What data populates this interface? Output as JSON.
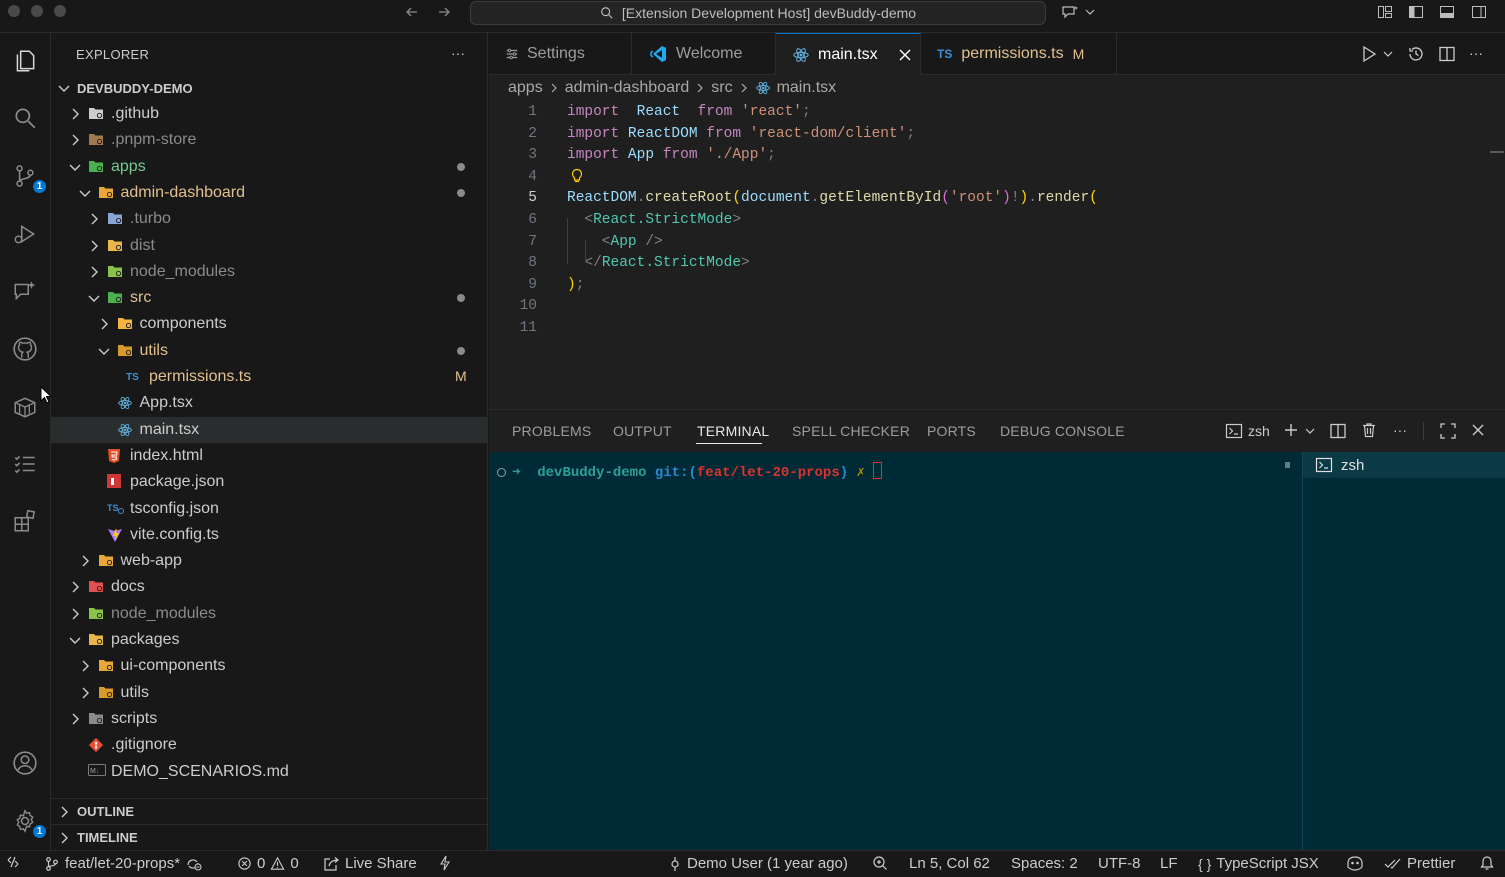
{
  "window": {
    "title": "[Extension Development Host] devBuddy-demo"
  },
  "activity_bar": {
    "scm_badge": "1",
    "settings_badge": "1"
  },
  "sidebar": {
    "title": "EXPLORER",
    "more_label": "···",
    "root": "DEVBUDDY-DEMO",
    "tree": [
      {
        "label": ".github",
        "level": 1,
        "kind": "folder",
        "expanded": false,
        "icon_color": "#cccccc"
      },
      {
        "label": ".pnpm-store",
        "level": 1,
        "kind": "folder",
        "expanded": false,
        "dim": true,
        "icon_color": "#a07a4d"
      },
      {
        "label": "apps",
        "level": 1,
        "kind": "folder",
        "expanded": true,
        "icon_color": "#4caf50",
        "status": "dot",
        "text_color": "#73c991"
      },
      {
        "label": "admin-dashboard",
        "level": 2,
        "kind": "folder",
        "expanded": true,
        "icon_color": "#e8a73a",
        "status": "dot",
        "text_color": "#e2c08d"
      },
      {
        "label": ".turbo",
        "level": 3,
        "kind": "folder",
        "expanded": false,
        "dim": true,
        "icon_color": "#8aa4d6"
      },
      {
        "label": "dist",
        "level": 3,
        "kind": "folder",
        "expanded": false,
        "dim": true,
        "icon_color": "#e8b64a"
      },
      {
        "label": "node_modules",
        "level": 3,
        "kind": "folder",
        "expanded": false,
        "dim": true,
        "icon_color": "#8bc34a"
      },
      {
        "label": "src",
        "level": 3,
        "kind": "folder",
        "expanded": true,
        "icon_color": "#4caf50",
        "status": "dot",
        "text_color": "#e2c08d"
      },
      {
        "label": "components",
        "level": 4,
        "kind": "folder",
        "expanded": false,
        "icon_color": "#f5b63f"
      },
      {
        "label": "utils",
        "level": 4,
        "kind": "folder",
        "expanded": true,
        "icon_color": "#d99a2b",
        "status": "dot",
        "text_color": "#e2c08d"
      },
      {
        "label": "permissions.ts",
        "level": 5,
        "kind": "ts",
        "status": "M",
        "text_color": "#e2c08d"
      },
      {
        "label": "App.tsx",
        "level": 4,
        "kind": "react"
      },
      {
        "label": "main.tsx",
        "level": 4,
        "kind": "react",
        "selected": true
      },
      {
        "label": "index.html",
        "level": 3,
        "kind": "html"
      },
      {
        "label": "package.json",
        "level": 3,
        "kind": "npm"
      },
      {
        "label": "tsconfig.json",
        "level": 3,
        "kind": "tsconfig"
      },
      {
        "label": "vite.config.ts",
        "level": 3,
        "kind": "vite"
      },
      {
        "label": "web-app",
        "level": 2,
        "kind": "folder",
        "expanded": false,
        "icon_color": "#e8a73a"
      },
      {
        "label": "docs",
        "level": 1,
        "kind": "folder",
        "expanded": false,
        "icon_color": "#e05252"
      },
      {
        "label": "node_modules",
        "level": 1,
        "kind": "folder",
        "expanded": false,
        "dim": true,
        "icon_color": "#8bc34a"
      },
      {
        "label": "packages",
        "level": 1,
        "kind": "folder",
        "expanded": true,
        "icon_color": "#e8b64a"
      },
      {
        "label": "ui-components",
        "level": 2,
        "kind": "folder",
        "expanded": false,
        "icon_color": "#e8a73a"
      },
      {
        "label": "utils",
        "level": 2,
        "kind": "folder",
        "expanded": false,
        "icon_color": "#d99a2b"
      },
      {
        "label": "scripts",
        "level": 1,
        "kind": "folder",
        "expanded": false,
        "icon_color": "#8a8a8a"
      },
      {
        "label": ".gitignore",
        "level": 1,
        "kind": "git"
      },
      {
        "label": "DEMO_SCENARIOS.md",
        "level": 1,
        "kind": "md"
      }
    ],
    "outline_label": "OUTLINE",
    "timeline_label": "TIMELINE"
  },
  "editor": {
    "tabs": [
      {
        "label": "Settings",
        "icon": "settings-icon"
      },
      {
        "label": "Welcome",
        "icon": "vscode-icon"
      },
      {
        "label": "main.tsx",
        "icon": "react-icon",
        "active": true
      },
      {
        "label": "permissions.ts",
        "icon": "ts-icon",
        "badge": "M"
      }
    ],
    "ts_label": "TS",
    "breadcrumb": [
      "apps",
      "admin-dashboard",
      "src",
      "main.tsx"
    ],
    "current_line": 5,
    "lines": [
      [
        [
          "kw",
          "import"
        ],
        [
          "",
          "  "
        ],
        [
          "id",
          "React"
        ],
        [
          "",
          "  "
        ],
        [
          "kw",
          "from"
        ],
        [
          "",
          " "
        ],
        [
          "st",
          "'react'"
        ],
        [
          "pn",
          ";"
        ]
      ],
      [
        [
          "kw",
          "import"
        ],
        [
          "",
          " "
        ],
        [
          "id",
          "ReactDOM"
        ],
        [
          "",
          " "
        ],
        [
          "kw",
          "from"
        ],
        [
          "",
          " "
        ],
        [
          "st",
          "'react-dom/client'"
        ],
        [
          "pn",
          ";"
        ]
      ],
      [
        [
          "kw",
          "import"
        ],
        [
          "",
          " "
        ],
        [
          "id",
          "App"
        ],
        [
          "",
          " "
        ],
        [
          "kw",
          "from"
        ],
        [
          "",
          " "
        ],
        [
          "st",
          "'./App'"
        ],
        [
          "pn",
          ";"
        ]
      ],
      [],
      [
        [
          "id",
          "ReactDOM"
        ],
        [
          "pn",
          "."
        ],
        [
          "fn",
          "createRoot"
        ],
        [
          "br",
          "("
        ],
        [
          "id",
          "document"
        ],
        [
          "pn",
          "."
        ],
        [
          "fn",
          "getElementById"
        ],
        [
          "br2",
          "("
        ],
        [
          "st",
          "'root'"
        ],
        [
          "br2",
          ")"
        ],
        [
          "pn",
          "!"
        ],
        [
          "br",
          ")"
        ],
        [
          "pn",
          "."
        ],
        [
          "fn",
          "render"
        ],
        [
          "br",
          "("
        ]
      ],
      [
        [
          "",
          ""
        ],
        [
          "pn",
          "  <"
        ],
        [
          "tg",
          "React.StrictMode"
        ],
        [
          "pn",
          ">"
        ]
      ],
      [
        [
          "",
          ""
        ],
        [
          "pn",
          "    <"
        ],
        [
          "tg",
          "App"
        ],
        [
          "",
          " "
        ],
        [
          "pn",
          "/>"
        ]
      ],
      [
        [
          "",
          ""
        ],
        [
          "pn",
          "  </"
        ],
        [
          "tg",
          "React.StrictMode"
        ],
        [
          "pn",
          ">"
        ]
      ],
      [
        [
          "br",
          ")"
        ],
        [
          "pn",
          ";"
        ]
      ],
      [],
      []
    ]
  },
  "panel": {
    "tabs": [
      "PROBLEMS",
      "OUTPUT",
      "TERMINAL",
      "SPELL CHECKER",
      "PORTS",
      "DEBUG CONSOLE"
    ],
    "active_tab": "TERMINAL",
    "shell_label": "zsh",
    "terminal": {
      "arrow": "➜",
      "dir": "devBuddy-demo",
      "git_prefix": "git:(",
      "branch": "feat/let-20-props",
      "git_suffix": ")",
      "dirty": "✗"
    },
    "terminal_list": [
      "zsh"
    ]
  },
  "status_bar": {
    "branch": "feat/let-20-props*",
    "errors": "0",
    "warnings": "0",
    "live_share": "Live Share",
    "blame": "Demo User (1 year ago)",
    "position": "Ln 5, Col 62",
    "spaces": "Spaces: 2",
    "encoding": "UTF-8",
    "eol": "LF",
    "language": "TypeScript JSX",
    "formatter": "Prettier"
  },
  "colors": {
    "accent": "#0078d4",
    "terminal_bg": "#002b36",
    "modified": "#e2c08d",
    "untracked": "#73c991"
  }
}
